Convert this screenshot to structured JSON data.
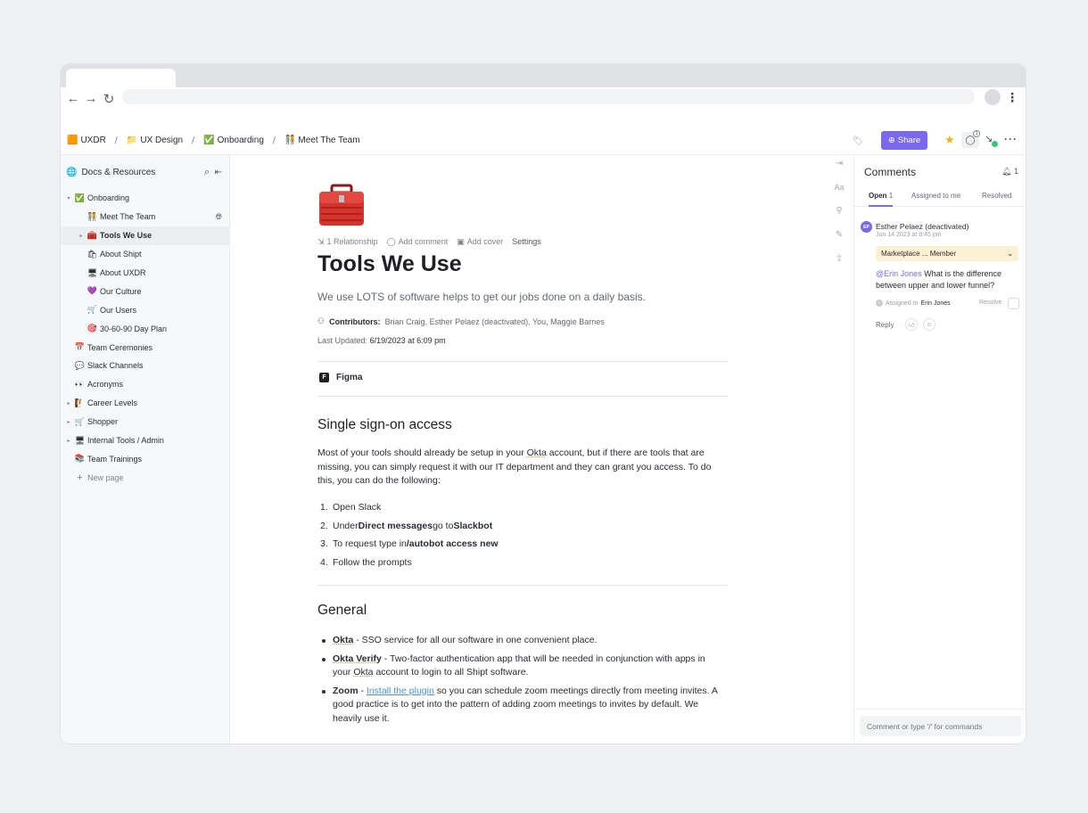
{
  "breadcrumb": [
    {
      "icon": "🟧",
      "label": "UXDR"
    },
    {
      "icon": "📁",
      "label": "UX Design"
    },
    {
      "icon": "✅",
      "label": "Onboarding"
    },
    {
      "icon": "🧑‍🤝‍🧑",
      "label": "Meet The Team"
    }
  ],
  "topbar": {
    "share_label": "Share",
    "share_icon": "⊕",
    "watchers_count": "1"
  },
  "sidebar": {
    "title": "Docs & Resources",
    "items": [
      {
        "level": 0,
        "caret": "▾",
        "icon": "✅",
        "label": "Onboarding"
      },
      {
        "level": 1,
        "caret": "",
        "icon": "🧑‍🤝‍🧑",
        "label": "Meet The Team",
        "globe": true
      },
      {
        "level": 1,
        "caret": "▸",
        "icon": "🧰",
        "label": "Tools We Use",
        "active": true
      },
      {
        "level": 1,
        "caret": "",
        "icon": "🛍",
        "label": "About Shipt"
      },
      {
        "level": 1,
        "caret": "",
        "icon": "🖥",
        "label": "About UXDR"
      },
      {
        "level": 1,
        "caret": "",
        "icon": "💜",
        "label": "Our Culture"
      },
      {
        "level": 1,
        "caret": "",
        "icon": "🛒",
        "label": "Our Users"
      },
      {
        "level": 1,
        "caret": "",
        "icon": "🎯",
        "label": "30-60-90 Day Plan"
      },
      {
        "level": 0,
        "caret": "",
        "icon": "📅",
        "label": "Team Ceremonies"
      },
      {
        "level": 0,
        "caret": "",
        "icon": "💬",
        "label": "Slack Channels"
      },
      {
        "level": 0,
        "caret": "",
        "icon": "👀",
        "label": "Acronyms"
      },
      {
        "level": 0,
        "caret": "▸",
        "icon": "🧗",
        "label": "Career Levels"
      },
      {
        "level": 0,
        "caret": "▸",
        "icon": "🛒",
        "label": "Shopper"
      },
      {
        "level": 0,
        "caret": "▸",
        "icon": "🖥",
        "label": "Internal Tools / Admin"
      },
      {
        "level": 0,
        "caret": "",
        "icon": "📚",
        "label": "Team Trainings"
      }
    ],
    "new_page": "New page"
  },
  "doc": {
    "page_icon": "🧰",
    "meta": {
      "relationship": "1 Relationship",
      "add_comment": "Add comment",
      "add_cover": "Add cover",
      "settings": "Settings"
    },
    "title": "Tools We Use",
    "subtitle": "We use LOTS of software helps to get our jobs done on a daily basis.",
    "contributors_label": "Contributors:",
    "contributors": "Brian Craig, Esther Pelaez (deactivated), You, Maggie Barnes",
    "last_updated_label": "Last Updated:",
    "last_updated": "6/19/2023 at 6:09 pm",
    "figma_label": "Figma",
    "section1_title": "Single sign-on access",
    "section1_para_a": "Most of your tools should already be setup in your ",
    "section1_para_okta": "Okta",
    "section1_para_b": " account, but if there are tools that are missing, you can simply request it with our IT department and they can grant you access. To do this, you can do the following:",
    "steps": [
      {
        "n": "1.",
        "pre": "Open Slack",
        "bold": "",
        "mid": "",
        "bold2": ""
      },
      {
        "n": "2.",
        "pre": "Under ",
        "bold": "Direct messages",
        "mid": " go to ",
        "bold2": "Slackbot"
      },
      {
        "n": "3.",
        "pre": "To request type in ",
        "bold": "/autobot access new",
        "mid": "",
        "bold2": ""
      },
      {
        "n": "4.",
        "pre": "Follow the prompts",
        "bold": "",
        "mid": "",
        "bold2": ""
      }
    ],
    "section2_title": "General",
    "bullets": {
      "okta_name": "Okta",
      "okta_text": " - SSO service for all our software in one convenient place.",
      "verify_name": "Okta Verify",
      "verify_text_a": " - Two-factor authentication app that will be needed in conjunction with apps in your ",
      "verify_okta": "Okta",
      "verify_text_b": " account to login to all Shipt software.",
      "zoom_name": "Zoom",
      "zoom_dash": " - ",
      "zoom_link": "Install the plugin",
      "zoom_text": " so you can schedule zoom meetings directly from meeting invites. A good practice is to get into the pattern of adding zoom meetings to invites by default. We heavily use it."
    }
  },
  "comments": {
    "title": "Comments",
    "bell_count": "1",
    "tabs": {
      "open": "Open",
      "open_count": "1",
      "assigned": "Assigned to me",
      "resolved": "Resolved"
    },
    "avatar_initials": "EP",
    "author": "Esther Pelaez (deactivated)",
    "date": "Jun 14 2023 at 8:45 pm",
    "select_value": "Marketplace ... Member",
    "mention": "@Erin Jones",
    "body": " What is the difference between upper and lower funnel?",
    "assigned_label": "Assigned to",
    "assigned_to": "Erin Jones",
    "resolve_label": "Resolve",
    "reply_label": "Reply",
    "input_placeholder": "Comment or type '/' for commands"
  }
}
